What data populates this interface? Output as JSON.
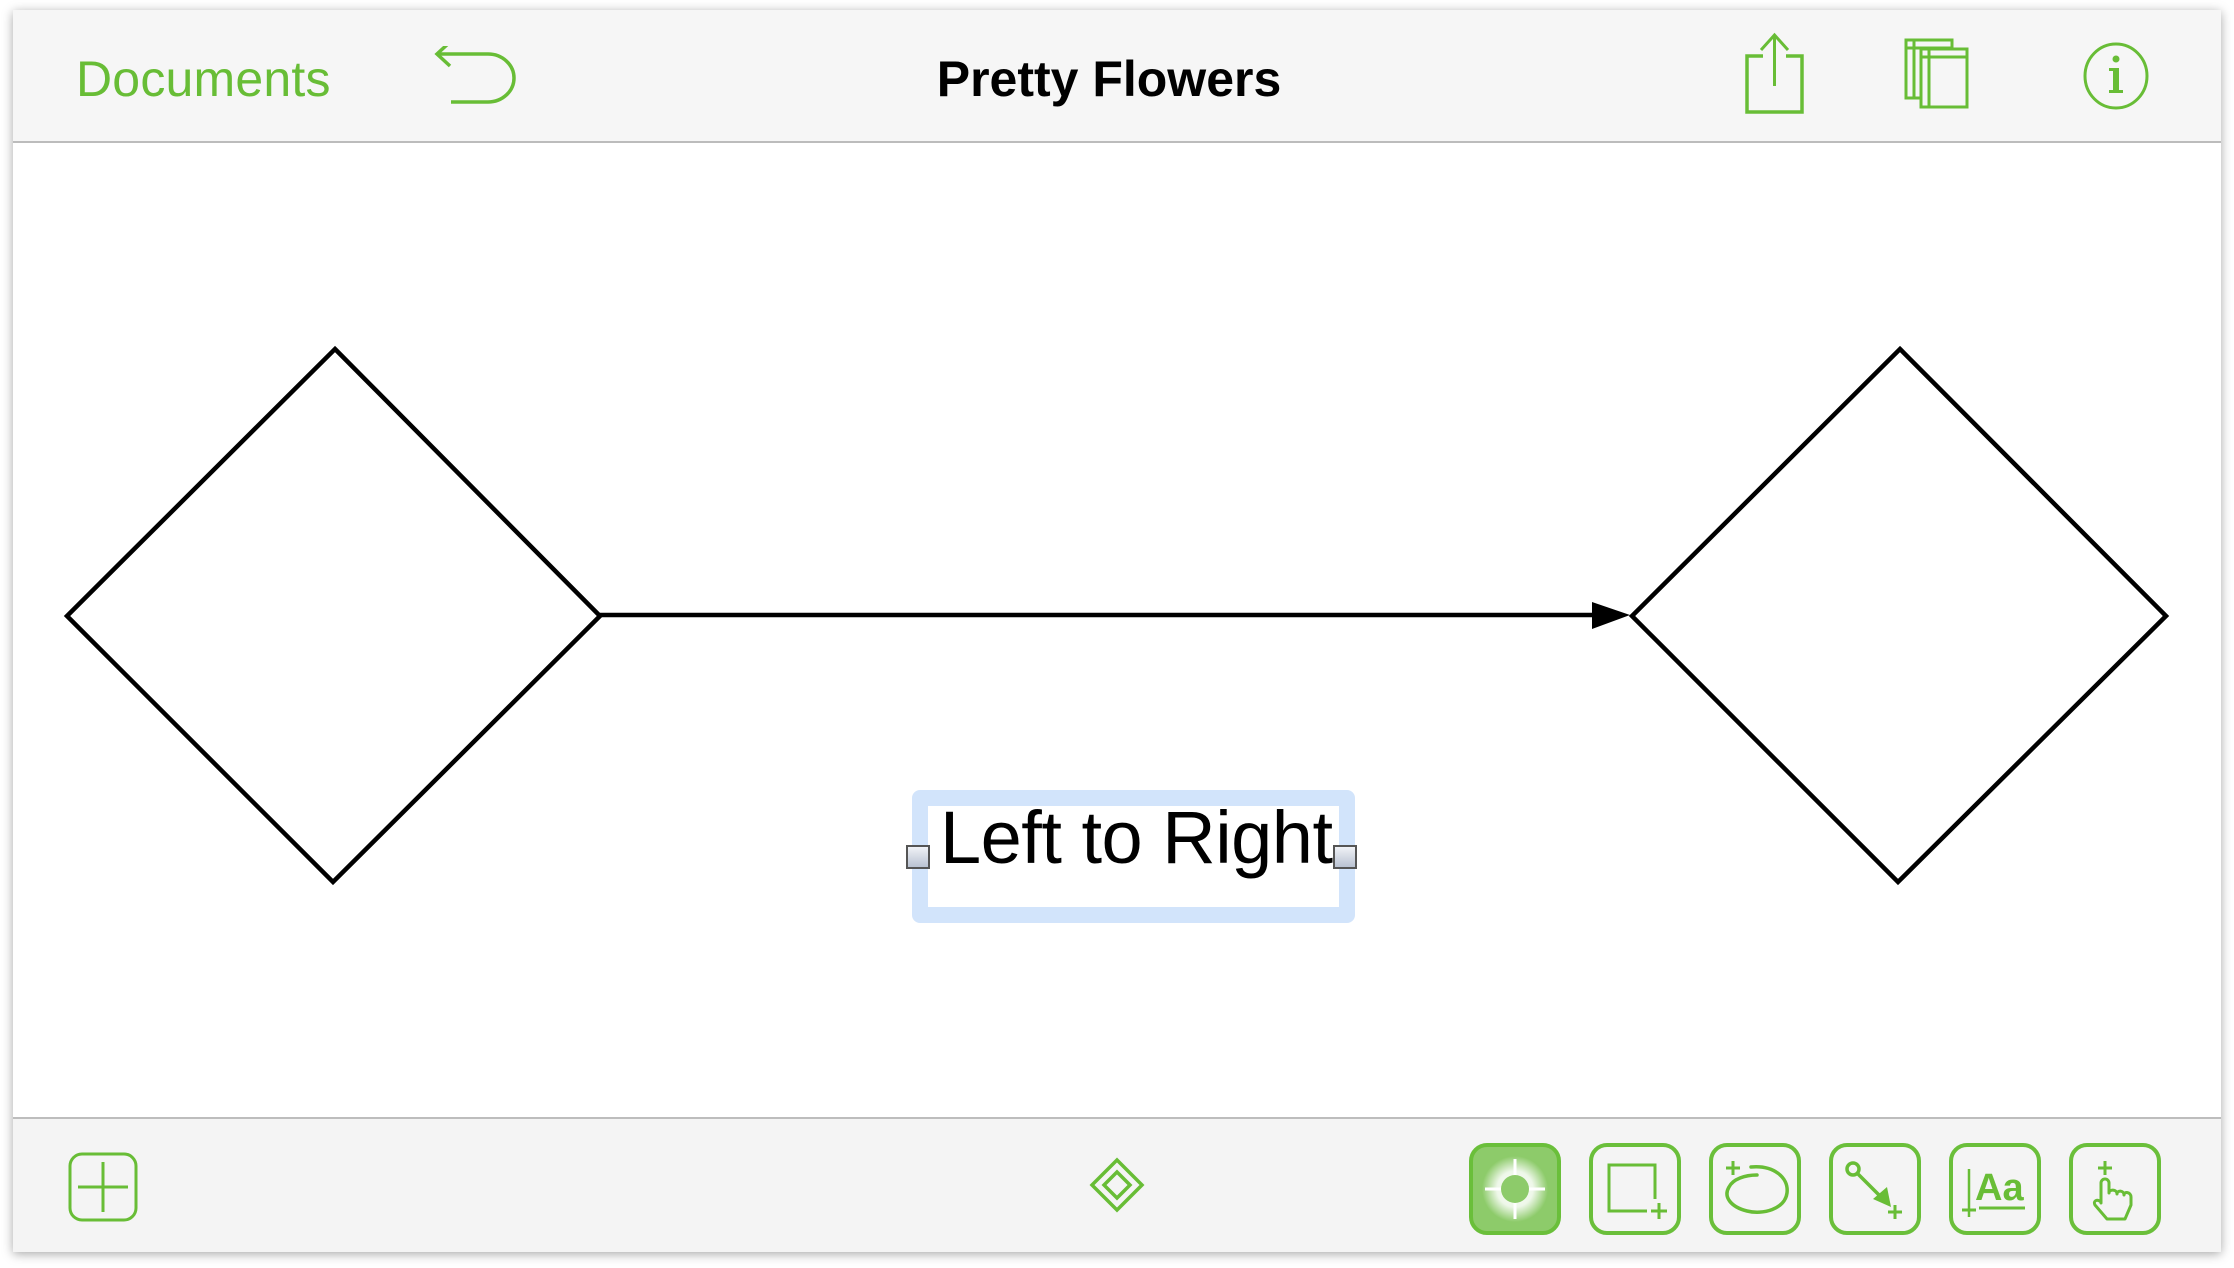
{
  "app": {
    "accent_color": "#68bd36",
    "active_tool_color": "#8dcb6a",
    "selection_color": "#d2e4fb"
  },
  "topbar": {
    "documents_label": "Documents",
    "title": "Pretty Flowers",
    "icons": {
      "undo": "undo-icon",
      "share": "share-icon",
      "canvases": "canvases-icon",
      "info": "info-icon"
    }
  },
  "canvas": {
    "shapes": [
      {
        "type": "diamond",
        "name": "left-diamond"
      },
      {
        "type": "diamond",
        "name": "right-diamond"
      }
    ],
    "connector": {
      "type": "arrow",
      "direction": "left-to-right",
      "from": "left-diamond",
      "to": "right-diamond"
    },
    "label": {
      "text": "Left to Right",
      "selected": true
    }
  },
  "bottombar": {
    "add_icon": "plus-icon",
    "center_icon": "diamond-outline-icon",
    "tools": [
      {
        "name": "selection-tool",
        "icon": "crosshair-icon",
        "active": true
      },
      {
        "name": "shape-tool",
        "icon": "rectangle-plus-icon",
        "active": false
      },
      {
        "name": "freehand-tool",
        "icon": "lasso-plus-icon",
        "active": false
      },
      {
        "name": "line-tool",
        "icon": "connector-plus-icon",
        "active": false
      },
      {
        "name": "text-tool",
        "icon": "text-aa-icon",
        "active": false
      },
      {
        "name": "touch-tool",
        "icon": "hand-pointer-icon",
        "active": false
      }
    ],
    "text_tool_glyph": "Aa"
  }
}
